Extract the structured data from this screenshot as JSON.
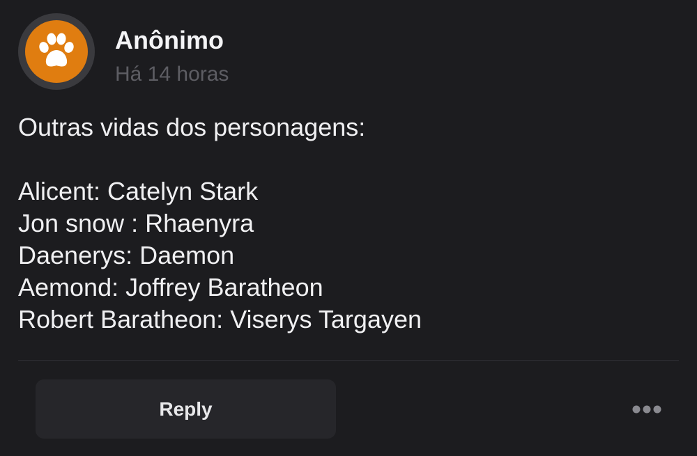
{
  "author": {
    "name": "Anônimo",
    "time": "Há 14 horas",
    "avatar_icon": "paw-icon",
    "avatar_color": "#e07d10"
  },
  "post": {
    "intro": "Outras vidas dos personagens:",
    "lines": [
      "Alicent: Catelyn Stark",
      "Jon snow : Rhaenyra",
      "Daenerys: Daemon",
      "Aemond: Joffrey Baratheon",
      "Robert Baratheon: Viserys Targayen"
    ]
  },
  "actions": {
    "reply_label": "Reply",
    "more_icon": "more-dots-icon"
  }
}
